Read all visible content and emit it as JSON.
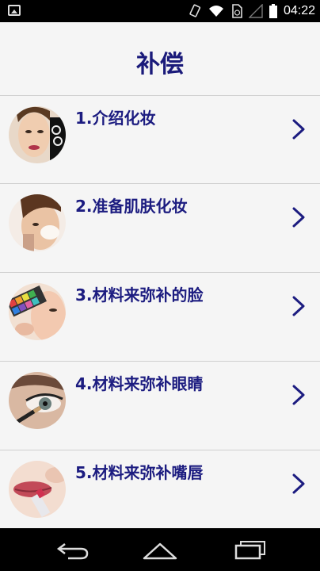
{
  "status_bar": {
    "time": "04:22",
    "icons": [
      "image-notification-icon",
      "rotate-icon",
      "wifi-icon",
      "sim-icon",
      "signal-icon",
      "battery-icon"
    ]
  },
  "page": {
    "title": "补偿"
  },
  "items": [
    {
      "label": "1.介绍化妆",
      "thumb": "face-with-brush-photo"
    },
    {
      "label": "2.准备肌肤化妆",
      "thumb": "face-cream-photo"
    },
    {
      "label": "3.材料来弥补的脸",
      "thumb": "eyeshadow-palette-photo"
    },
    {
      "label": "4.材料来弥补眼睛",
      "thumb": "eye-makeup-photo"
    },
    {
      "label": "5.材料来弥补嘴唇",
      "thumb": "lipstick-photo"
    }
  ],
  "nav_bar": {
    "buttons": [
      "back-icon",
      "home-icon",
      "recents-icon"
    ]
  },
  "colors": {
    "accent": "#1c1c80",
    "background": "#f5f5f5",
    "divider": "#cfcfcf"
  }
}
